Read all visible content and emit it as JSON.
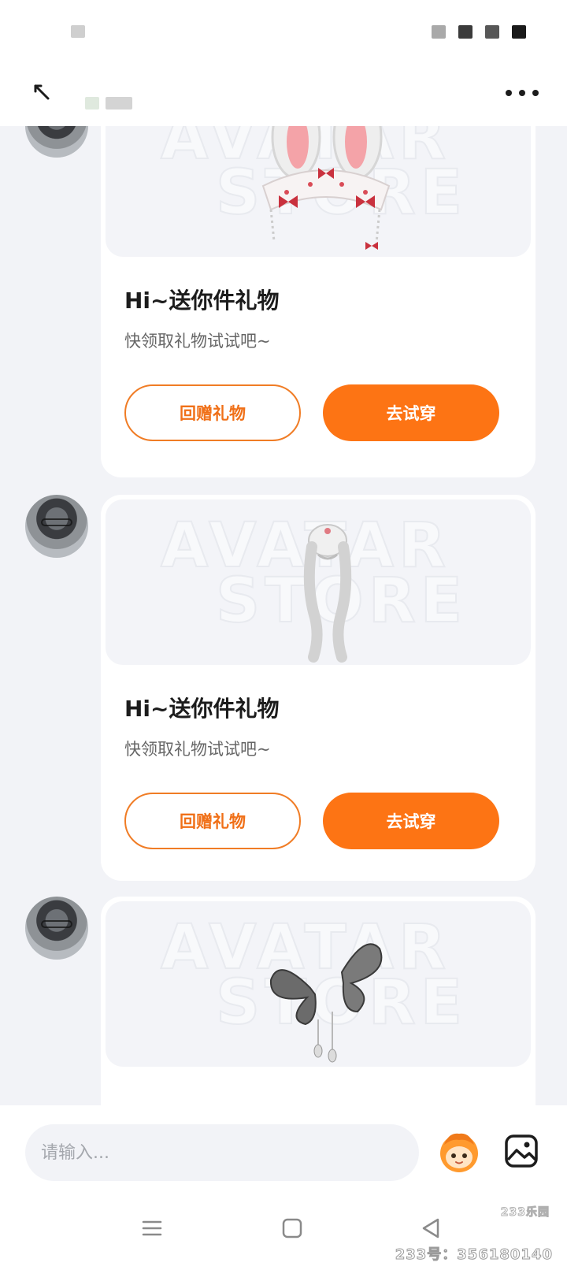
{
  "header": {
    "contact_name": "",
    "back_label": "back",
    "more_label": "more"
  },
  "messages": [
    {
      "title": "Hi~送你件礼物",
      "subtitle": "快领取礼物试试吧~",
      "gift_back_label": "回赠礼物",
      "try_on_label": "去试穿",
      "item_icon": "bunny-ears-headband-icon"
    },
    {
      "title": "Hi~送你件礼物",
      "subtitle": "快领取礼物试试吧~",
      "gift_back_label": "回赠礼物",
      "try_on_label": "去试穿",
      "item_icon": "silver-hair-icon"
    },
    {
      "item_icon": "butterfly-hairpin-icon"
    }
  ],
  "preview_watermark": {
    "line1": "AVATAR",
    "line2": "STORE"
  },
  "input": {
    "placeholder": "请输入..."
  },
  "watermark": {
    "logo": "233乐园",
    "id_text": "233号：356180140"
  },
  "colors": {
    "accent": "#fd7414",
    "accent_outline": "#f07c25",
    "background": "#f2f3f7",
    "card": "#ffffff"
  }
}
